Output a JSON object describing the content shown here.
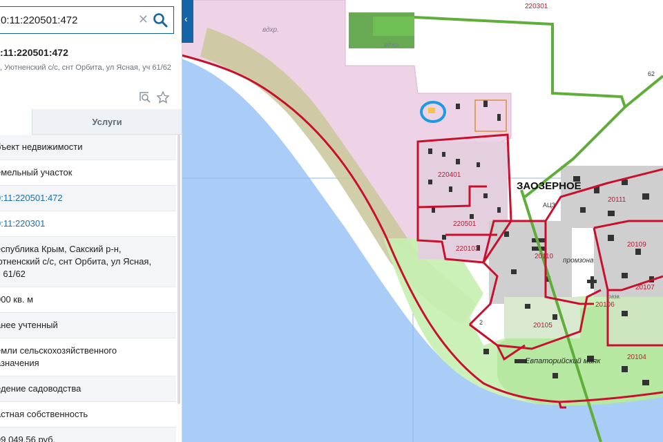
{
  "search": {
    "value": "0:11:220501:472"
  },
  "object": {
    "title": ":11:220501:472",
    "address": ", Уютненский с/с, снт Орбита, ул Ясная, уч 61/62"
  },
  "tabs": {
    "left": "",
    "right": "Услуги"
  },
  "rows": [
    {
      "text": "бъект недвижимости",
      "link": false
    },
    {
      "text": "емельный участок",
      "link": false
    },
    {
      "text": "0:11:220501:472",
      "link": true
    },
    {
      "text": "0:11:220301",
      "link": true
    },
    {
      "text": "еспублика Крым, Сакский р-н,\nютненский с/с, снт Орбита, ул Ясная,\nч 61/62",
      "link": false
    },
    {
      "text": "000 кв. м",
      "link": false
    },
    {
      "text": "анее учтенный",
      "link": false
    },
    {
      "text": "емли сельскохозяйственного\nазначения",
      "link": false
    },
    {
      "text": "едение садоводства",
      "link": false
    },
    {
      "text": "астная собственность",
      "link": false
    },
    {
      "text": "99 049,56 руб.",
      "link": false
    }
  ],
  "map_labels": {
    "q220301": "220301",
    "q220401": "220401",
    "q220501": "220501",
    "q220103": "220103",
    "q20111": "20111",
    "q20110": "20110",
    "q20109": "20109",
    "q20107": "20107",
    "q20106": "20106",
    "q20105": "20105",
    "q20104": "20104",
    "town": "ЗАОЗЕРНОЕ",
    "promzona": "промзона",
    "mayak": "Евпаторийский маяк",
    "vdhr1": "вдхр.",
    "vdhr2": "вдхр.",
    "au3": "АЦЗ",
    "raz": "разв.",
    "num2": "2",
    "num62": "62"
  },
  "colors": {
    "sea": "#a9cdf7",
    "boundary": "#c8102e",
    "pink_zone": "#eed3e6",
    "beach": "#c9c79a",
    "green_zone": "#c6f0b0",
    "road_green": "#5fae3a",
    "selection": "#1e9be0",
    "accent": "#1565a6"
  }
}
